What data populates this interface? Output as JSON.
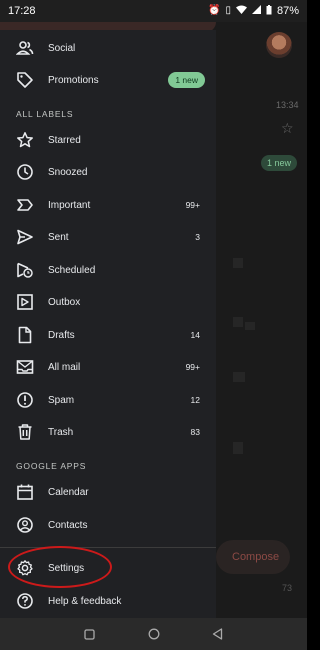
{
  "status_bar": {
    "time": "17:28",
    "battery": "87%",
    "icons": [
      "alarm-icon",
      "vibrate-icon",
      "wifi-icon",
      "signal-icon",
      "battery-icon"
    ]
  },
  "background": {
    "time": "13:34",
    "new_badge": "1 new",
    "compose_label": "Compose",
    "count": "73"
  },
  "drawer": {
    "top_items": [
      {
        "label": "Social",
        "icon": "people-icon"
      },
      {
        "label": "Promotions",
        "icon": "tag-icon",
        "badge": "1 new"
      }
    ],
    "all_labels_heading": "ALL LABELS",
    "labels": [
      {
        "label": "Starred",
        "count": "",
        "icon": "star-icon"
      },
      {
        "label": "Snoozed",
        "count": "",
        "icon": "clock-icon"
      },
      {
        "label": "Important",
        "count": "99+",
        "icon": "important-icon"
      },
      {
        "label": "Sent",
        "count": "3",
        "icon": "send-icon"
      },
      {
        "label": "Scheduled",
        "count": "",
        "icon": "scheduled-send-icon"
      },
      {
        "label": "Outbox",
        "count": "",
        "icon": "outbox-icon"
      },
      {
        "label": "Drafts",
        "count": "14",
        "icon": "draft-icon"
      },
      {
        "label": "All mail",
        "count": "99+",
        "icon": "all-mail-icon"
      },
      {
        "label": "Spam",
        "count": "12",
        "icon": "spam-icon"
      },
      {
        "label": "Trash",
        "count": "83",
        "icon": "trash-icon"
      }
    ],
    "google_apps_heading": "GOOGLE APPS",
    "apps": [
      {
        "label": "Calendar",
        "icon": "calendar-icon"
      },
      {
        "label": "Contacts",
        "icon": "contacts-icon"
      }
    ],
    "bottom_items": [
      {
        "label": "Settings",
        "icon": "gear-icon"
      },
      {
        "label": "Help & feedback",
        "icon": "help-icon"
      }
    ]
  },
  "colors": {
    "drawer_bg": "#202124",
    "badge_green": "#81c995",
    "highlight_red": "#cc1a1a"
  },
  "nav_bar": {
    "buttons": [
      "recents-button",
      "home-button",
      "back-button"
    ]
  }
}
